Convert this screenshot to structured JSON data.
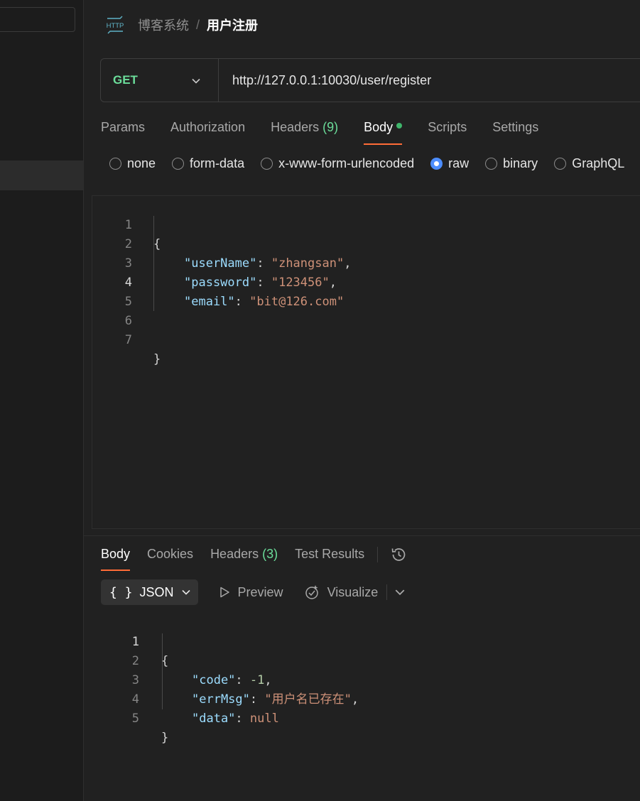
{
  "breadcrumb": {
    "icon": "HTTP",
    "parent": "博客系统",
    "separator": "/",
    "current": "用户注册"
  },
  "request": {
    "method": "GET",
    "url": "http://127.0.0.1:10030/user/register"
  },
  "request_tabs": [
    {
      "label": "Params"
    },
    {
      "label": "Authorization"
    },
    {
      "label": "Headers",
      "count": "(9)"
    },
    {
      "label": "Body",
      "active": true
    },
    {
      "label": "Scripts"
    },
    {
      "label": "Settings"
    }
  ],
  "body_types": [
    {
      "label": "none"
    },
    {
      "label": "form-data"
    },
    {
      "label": "x-www-form-urlencoded"
    },
    {
      "label": "raw",
      "checked": true
    },
    {
      "label": "binary"
    },
    {
      "label": "GraphQL"
    }
  ],
  "request_body_lines": [
    {
      "n": "1",
      "text": "{"
    },
    {
      "n": "2",
      "key": "\"userName\"",
      "val": "\"zhangsan\"",
      "tail": ","
    },
    {
      "n": "3",
      "key": "\"password\"",
      "val": "\"123456\"",
      "tail": ","
    },
    {
      "n": "4",
      "key": "\"email\"",
      "val": "\"bit@126.com\"",
      "tail": ""
    },
    {
      "n": "5",
      "text": ""
    },
    {
      "n": "6",
      "text": ""
    },
    {
      "n": "7",
      "text": "}"
    }
  ],
  "response_tabs": [
    {
      "label": "Body",
      "active": true
    },
    {
      "label": "Cookies"
    },
    {
      "label": "Headers",
      "count": "(3)"
    },
    {
      "label": "Test Results"
    }
  ],
  "response_toolbar": {
    "format_icon": "{ }",
    "format": "JSON",
    "preview": "Preview",
    "visualize": "Visualize"
  },
  "response_body_lines": [
    {
      "n": "1",
      "text": "{"
    },
    {
      "n": "2",
      "key": "\"code\"",
      "num": "-1",
      "tail": ","
    },
    {
      "n": "3",
      "key": "\"errMsg\"",
      "val": "\"用户名已存在\"",
      "tail": ","
    },
    {
      "n": "4",
      "key": "\"data\"",
      "val": "null",
      "tail": ""
    },
    {
      "n": "5",
      "text": "}"
    }
  ]
}
